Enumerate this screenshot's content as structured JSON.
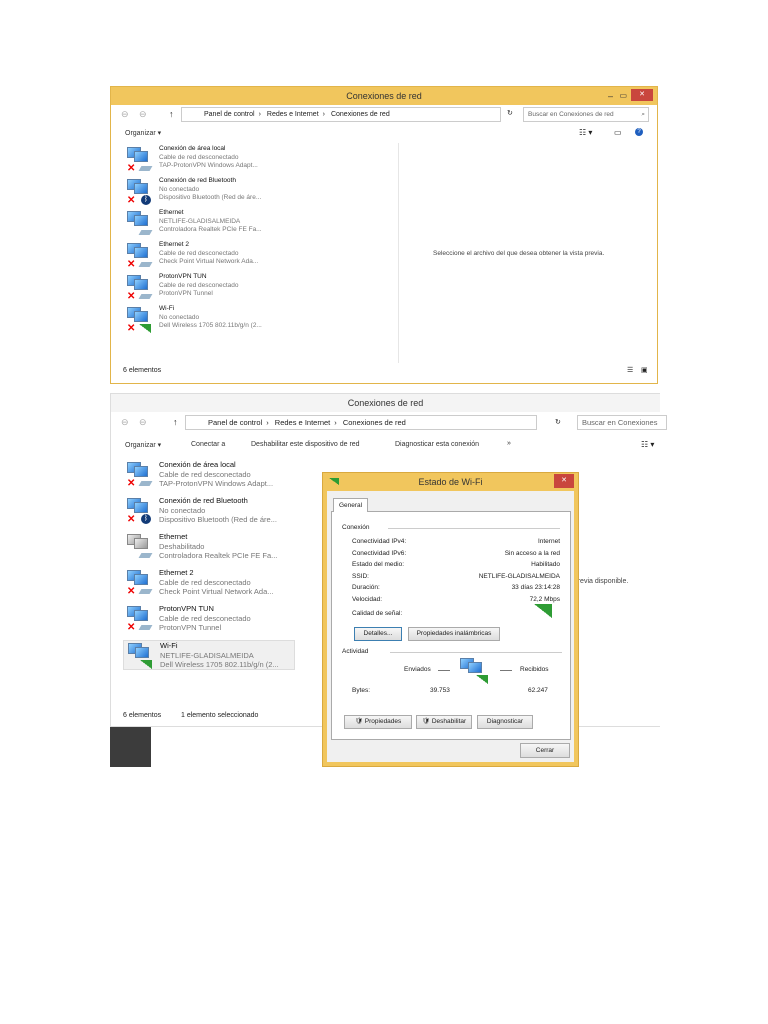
{
  "window1": {
    "title": "Conexiones de red",
    "breadcrumb": [
      "Panel de control",
      "Redes e Internet",
      "Conexiones de red"
    ],
    "search_placeholder": "Buscar en Conexiones de red",
    "toolbar": {
      "organize": "Organizar ▾"
    },
    "items": [
      {
        "name": "Conexión de área local",
        "status": "Cable de red desconectado",
        "device": "TAP-ProtonVPN Windows Adapt...",
        "icon": "x"
      },
      {
        "name": "Conexión de red Bluetooth",
        "status": "No conectado",
        "device": "Dispositivo Bluetooth (Red de áre...",
        "icon": "bt"
      },
      {
        "name": "Ethernet",
        "status": "NETLIFE-GLADISALMEIDA",
        "device": "Controladora Realtek PCIe FE Fa...",
        "icon": "cable"
      },
      {
        "name": "Ethernet 2",
        "status": "Cable de red desconectado",
        "device": "Check Point Virtual Network Ada...",
        "icon": "x"
      },
      {
        "name": "ProtonVPN TUN",
        "status": "Cable de red desconectado",
        "device": "ProtonVPN Tunnel",
        "icon": "x"
      },
      {
        "name": "Wi-Fi",
        "status": "No conectado",
        "device": "Dell Wireless 1705 802.11b/g/n (2...",
        "icon": "wifi-x"
      }
    ],
    "preview_text": "Seleccione el archivo del que desea obtener la vista previa.",
    "status": "6 elementos"
  },
  "window2": {
    "title": "Conexiones de red",
    "breadcrumb": [
      "Panel de control",
      "Redes e Internet",
      "Conexiones de red"
    ],
    "search_placeholder": "Buscar en Conexiones",
    "toolbar": {
      "organize": "Organizar ▾",
      "connect": "Conectar a",
      "disable": "Deshabilitar este dispositivo de red",
      "diagnose": "Diagnosticar esta conexión",
      "more": "»"
    },
    "items": [
      {
        "name": "Conexión de área local",
        "status": "Cable de red desconectado",
        "device": "TAP-ProtonVPN Windows Adapt..."
      },
      {
        "name": "Conexión de red Bluetooth",
        "status": "No conectado",
        "device": "Dispositivo Bluetooth (Red de áre..."
      },
      {
        "name": "Ethernet",
        "status": "Deshabilitado",
        "device": "Controladora Realtek PCIe FE Fa..."
      },
      {
        "name": "Ethernet 2",
        "status": "Cable de red desconectado",
        "device": "Check Point Virtual Network Ada..."
      },
      {
        "name": "ProtonVPN TUN",
        "status": "Cable de red desconectado",
        "device": "ProtonVPN Tunnel"
      },
      {
        "name": "Wi-Fi",
        "status": "NETLIFE-GLADISALMEIDA",
        "device": "Dell Wireless 1705 802.11b/g/n (2..."
      }
    ],
    "preview_text": "a previa disponible.",
    "status": "6 elementos",
    "selected": "1 elemento seleccionado"
  },
  "dialog": {
    "title": "Estado de Wi-Fi",
    "close": "✕",
    "tab": "General",
    "connection_heading": "Conexión",
    "rows": [
      {
        "label": "Conectividad IPv4:",
        "value": "Internet"
      },
      {
        "label": "Conectividad IPv6:",
        "value": "Sin acceso a la red"
      },
      {
        "label": "Estado del medio:",
        "value": "Habilitado"
      },
      {
        "label": "SSID:",
        "value": "NETLIFE-GLADISALMEIDA"
      },
      {
        "label": "Duración:",
        "value": "33 días 23:14:28"
      },
      {
        "label": "Velocidad:",
        "value": "72,2 Mbps"
      }
    ],
    "signal_label": "Calidad de señal:",
    "details_btn": "Detalles...",
    "wireless_btn": "Propiedades inalámbricas",
    "activity_heading": "Actividad",
    "sent": "Enviados",
    "received": "Recibidos",
    "bytes_label": "Bytes:",
    "bytes_sent": "39.753",
    "bytes_received": "62.247",
    "properties_btn": "Propiedades",
    "disable_btn": "Deshabilitar",
    "diagnose_btn": "Diagnosticar",
    "close_btn": "Cerrar"
  }
}
